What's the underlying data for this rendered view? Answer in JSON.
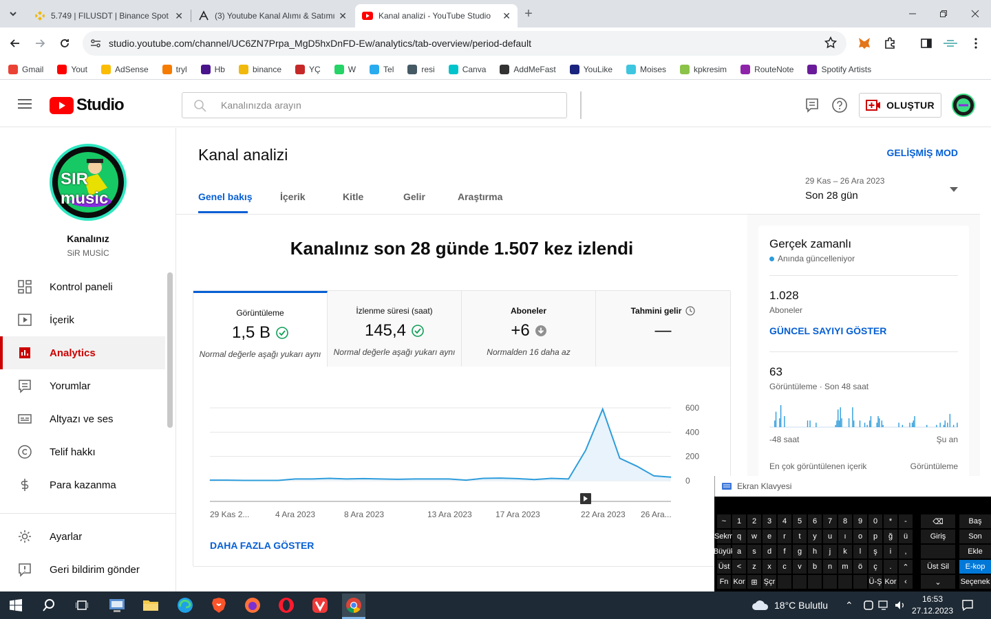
{
  "browser": {
    "tabs": [
      {
        "title": "5.749 | FILUSDT | Binance Spot",
        "active": false
      },
      {
        "title": "(3) Youtube Kanal Alımı & Satımı",
        "active": false
      },
      {
        "title": "Kanal analizi - YouTube Studio",
        "active": true
      }
    ],
    "url": "studio.youtube.com/channel/UC6ZN7Prpa_MgD5hxDnFD-Ew/analytics/tab-overview/period-default",
    "bookmarks": [
      "Gmail",
      "Yout",
      "AdSense",
      "tryl",
      "Hb",
      "binance",
      "YÇ",
      "W",
      "Tel",
      "resi",
      "Canva",
      "AddMeFast",
      "YouLike",
      "Moises",
      "kpkresim",
      "RouteNote",
      "Spotify Artists"
    ]
  },
  "studio": {
    "logo_text": "Studio",
    "search_placeholder": "Kanalınızda arayın",
    "create_label": "OLUŞTUR"
  },
  "channel": {
    "label": "Kanalınız",
    "name": "SiR MUSİC",
    "avatar_text": "SIR music"
  },
  "sidebar": {
    "items": [
      {
        "label": "Kontrol paneli"
      },
      {
        "label": "İçerik"
      },
      {
        "label": "Analytics"
      },
      {
        "label": "Yorumlar"
      },
      {
        "label": "Altyazı ve ses"
      },
      {
        "label": "Telif hakkı"
      },
      {
        "label": "Para kazanma"
      }
    ],
    "bottom": [
      {
        "label": "Ayarlar"
      },
      {
        "label": "Geri bildirim gönder"
      }
    ]
  },
  "page": {
    "title": "Kanal analizi",
    "advanced_mode": "GELİŞMİŞ MOD",
    "tabs": [
      "Genel bakış",
      "İçerik",
      "Kitle",
      "Gelir",
      "Araştırma"
    ],
    "date_range": "29 Kas – 26 Ara 2023",
    "period": "Son 28 gün",
    "headline": "Kanalınız son 28 günde 1.507 kez izlendi",
    "metrics": [
      {
        "label": "Görüntüleme",
        "value": "1,5 B",
        "note": "Normal değerle aşağı yukarı aynı"
      },
      {
        "label": "İzlenme süresi (saat)",
        "value": "145,4",
        "note": "Normal değerle aşağı yukarı aynı"
      },
      {
        "label": "Aboneler",
        "value": "+6",
        "note": "Normalden 16 daha az"
      },
      {
        "label": "Tahmini gelir",
        "value": "—",
        "note": ""
      }
    ],
    "show_more": "DAHA FAZLA GÖSTER"
  },
  "chart_data": {
    "type": "area",
    "x_labels": [
      "29 Kas 2...",
      "4 Ara 2023",
      "8 Ara 2023",
      "13 Ara 2023",
      "17 Ara 2023",
      "22 Ara 2023",
      "26 Ara..."
    ],
    "y_ticks": [
      0,
      200,
      400,
      600
    ],
    "ylim": [
      0,
      600
    ],
    "values": [
      5,
      5,
      3,
      3,
      3,
      15,
      15,
      20,
      15,
      18,
      15,
      12,
      15,
      15,
      15,
      5,
      20,
      22,
      18,
      10,
      20,
      15,
      250,
      590,
      185,
      120,
      40,
      30
    ]
  },
  "realtime": {
    "title": "Gerçek zamanlı",
    "subtitle": "Anında güncelleniyor",
    "subs_value": "1.028",
    "subs_label": "Aboneler",
    "show_count": "GÜNCEL SAYIYI GÖSTER",
    "views_value": "63",
    "views_label": "Görüntüleme · Son 48 saat",
    "axis_left": "-48 saat",
    "axis_right": "Şu an",
    "top_content": "En çok görüntülenen içerik",
    "top_views": "Görüntüleme",
    "bars": [
      0,
      0,
      0,
      0,
      3,
      7,
      0,
      0,
      4,
      10,
      0,
      0,
      5,
      0,
      0,
      0,
      0,
      0,
      0,
      0,
      0,
      0,
      0,
      0,
      0,
      0,
      0,
      0,
      0,
      0,
      0,
      3,
      0,
      3,
      0,
      0,
      0,
      0,
      2,
      0,
      0,
      0,
      0,
      0,
      0,
      0,
      0,
      0,
      0,
      0,
      0,
      0,
      0,
      0,
      1,
      3,
      8,
      3,
      9,
      4,
      0,
      0,
      0,
      0,
      0,
      4,
      0,
      0,
      9,
      3,
      0,
      0,
      0,
      0,
      3,
      0,
      0,
      0,
      2,
      0,
      1,
      0,
      3,
      5,
      0,
      0,
      0,
      0,
      2,
      5,
      4,
      0,
      3,
      1,
      0,
      0,
      0,
      0,
      0,
      0,
      0,
      0,
      0,
      0,
      0,
      0,
      2,
      0,
      0,
      1,
      0,
      0,
      0,
      0,
      0,
      2,
      0,
      2,
      3,
      5,
      0,
      0,
      0,
      0,
      0,
      0,
      0,
      0,
      0,
      1,
      0,
      0,
      0,
      0,
      0,
      0,
      0,
      1,
      0,
      0,
      2,
      0,
      0,
      1,
      3,
      0,
      2,
      0,
      6,
      0,
      0,
      1,
      0,
      0,
      2
    ]
  },
  "keyboard": {
    "title": "Ekran Klavyesi"
  },
  "taskbar": {
    "weather": "18°C Bulutlu",
    "time": "16:53",
    "date": "27.12.2023"
  }
}
